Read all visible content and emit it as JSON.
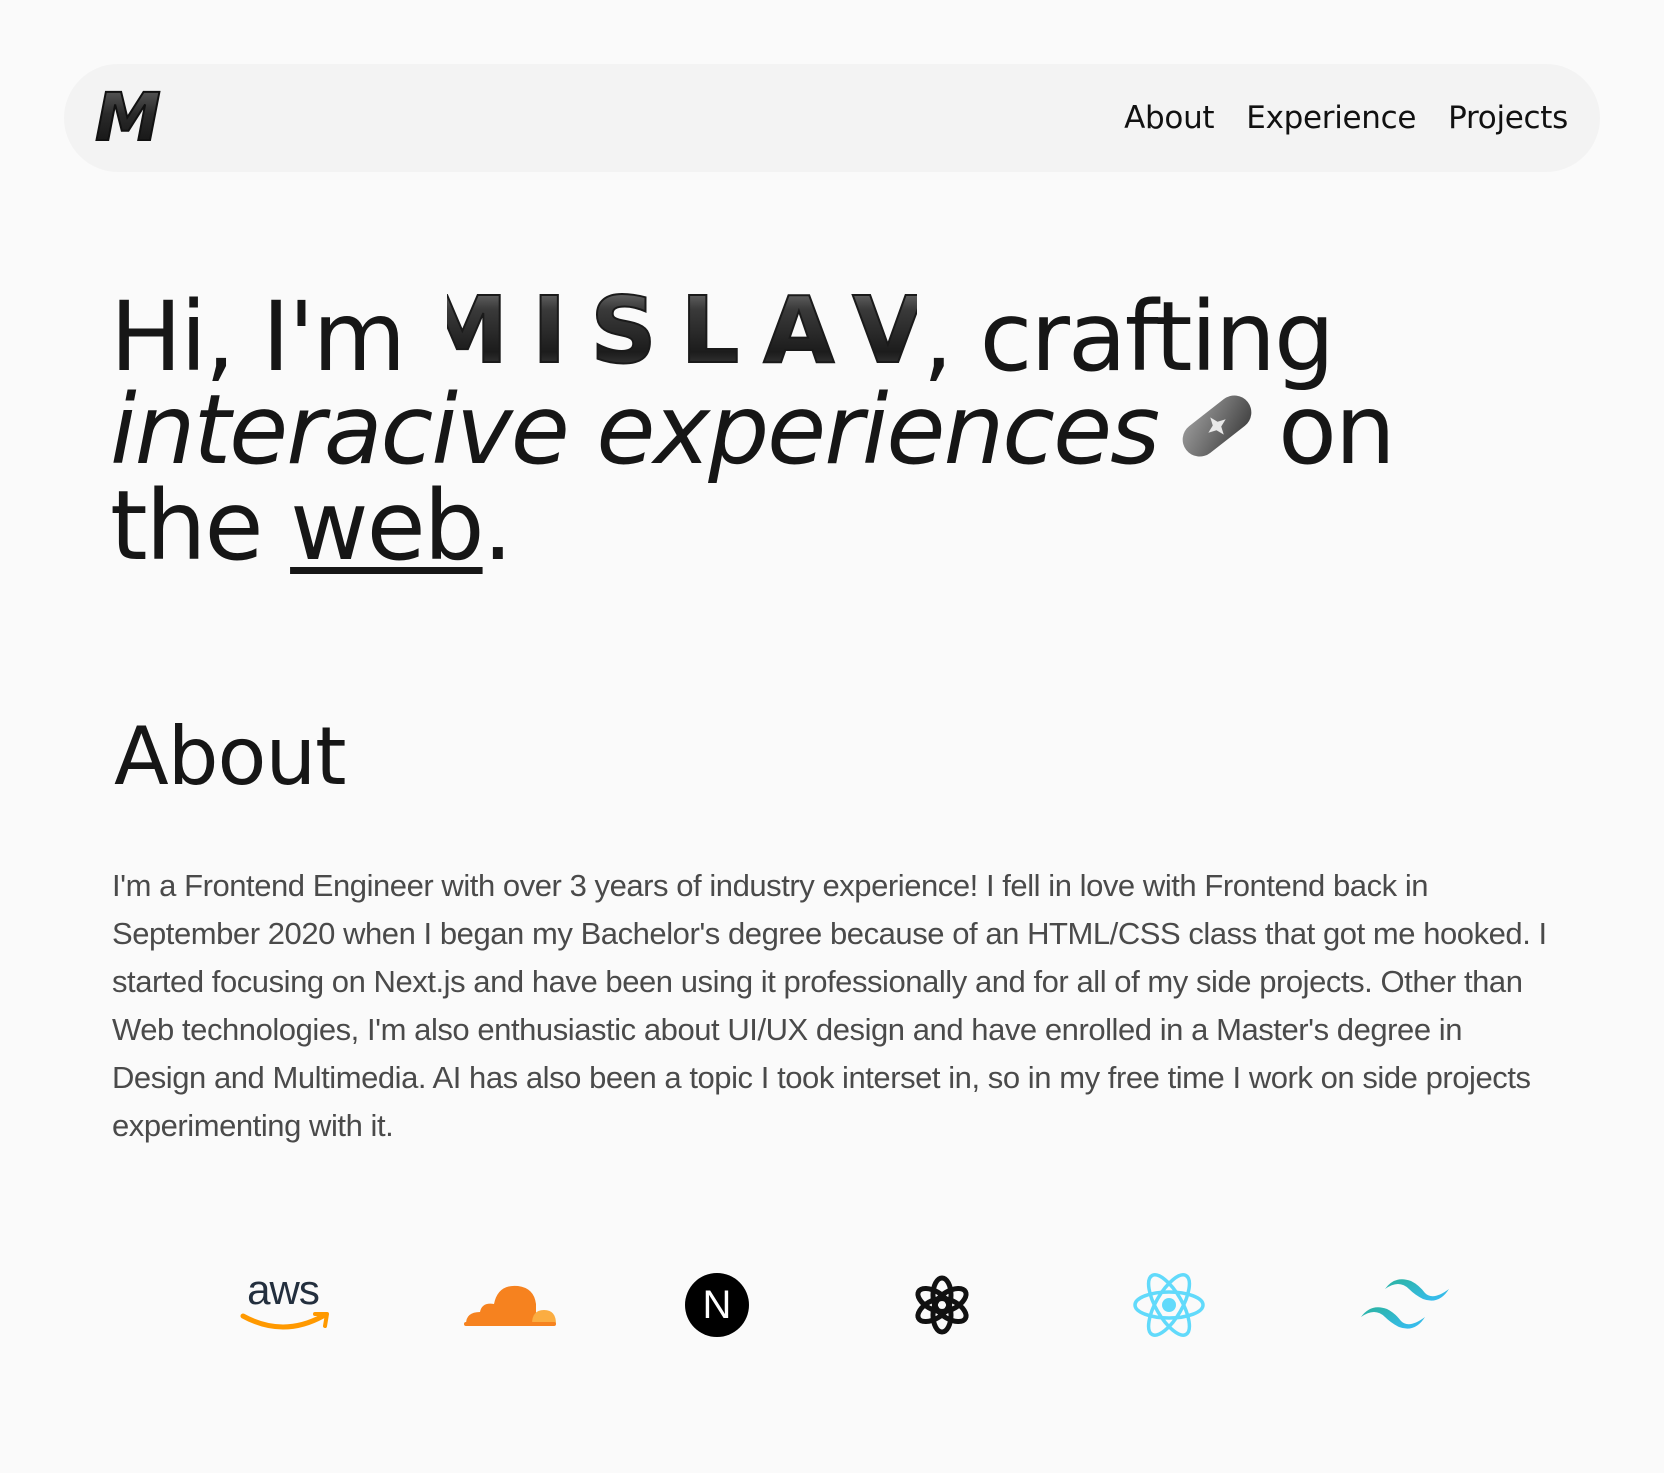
{
  "nav": {
    "logo_text": "M",
    "links": [
      {
        "label": "About"
      },
      {
        "label": "Experience"
      },
      {
        "label": "Projects"
      }
    ]
  },
  "hero": {
    "greeting": "Hi, I'm ",
    "name": "MISLAV",
    "after_name": ", crafting",
    "italic_phrase": "interacive experiences",
    "after_icon": "on",
    "line3_prefix": "the ",
    "link_word": "web",
    "period": "."
  },
  "about": {
    "title": "About",
    "body": "I'm a Frontend Engineer with over 3 years of industry experience! I fell in love with Frontend back in September 2020 when I began my Bachelor's degree because of an HTML/CSS class that got me hooked. I started focusing on Next.js and have been using it professionally and for all of my side projects. Other than Web technologies, I'm also enthusiastic about UI/UX design and have enrolled in a Master's degree in Design and Multimedia. AI has also been a topic I took interset in, so in my free time I work on side projects experimenting with it."
  },
  "tech_logos": {
    "aws_text": "aws",
    "nextjs_letter": "N",
    "items": [
      "aws-icon",
      "cloudflare-icon",
      "nextjs-icon",
      "openai-icon",
      "react-icon",
      "tailwind-icon"
    ]
  },
  "colors": {
    "background": "#fafafa",
    "navbar": "#f3f3f3",
    "text": "#161616",
    "body_text": "#4a4a4a",
    "aws_orange": "#ff9900",
    "cloudflare_orange": "#f6821f",
    "react_blue": "#61dafb",
    "tailwind_teal": "#38bdf8"
  }
}
